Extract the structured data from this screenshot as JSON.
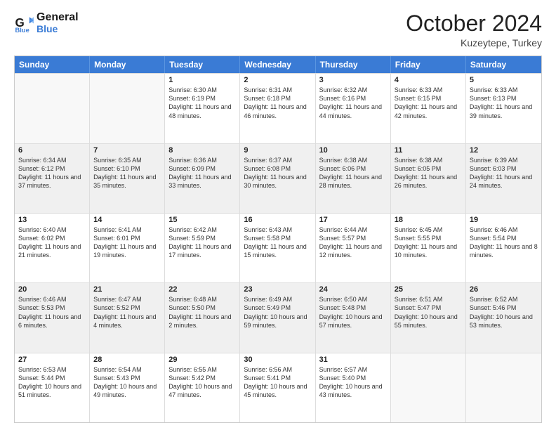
{
  "header": {
    "logo_line1": "General",
    "logo_line2": "Blue",
    "month": "October 2024",
    "location": "Kuzeytepe, Turkey"
  },
  "days": [
    "Sunday",
    "Monday",
    "Tuesday",
    "Wednesday",
    "Thursday",
    "Friday",
    "Saturday"
  ],
  "rows": [
    [
      {
        "day": "",
        "empty": true
      },
      {
        "day": "",
        "empty": true
      },
      {
        "day": "1",
        "sunrise": "6:30 AM",
        "sunset": "6:19 PM",
        "daylight": "11 hours and 48 minutes."
      },
      {
        "day": "2",
        "sunrise": "6:31 AM",
        "sunset": "6:18 PM",
        "daylight": "11 hours and 46 minutes."
      },
      {
        "day": "3",
        "sunrise": "6:32 AM",
        "sunset": "6:16 PM",
        "daylight": "11 hours and 44 minutes."
      },
      {
        "day": "4",
        "sunrise": "6:33 AM",
        "sunset": "6:15 PM",
        "daylight": "11 hours and 42 minutes."
      },
      {
        "day": "5",
        "sunrise": "6:33 AM",
        "sunset": "6:13 PM",
        "daylight": "11 hours and 39 minutes."
      }
    ],
    [
      {
        "day": "6",
        "sunrise": "6:34 AM",
        "sunset": "6:12 PM",
        "daylight": "11 hours and 37 minutes."
      },
      {
        "day": "7",
        "sunrise": "6:35 AM",
        "sunset": "6:10 PM",
        "daylight": "11 hours and 35 minutes."
      },
      {
        "day": "8",
        "sunrise": "6:36 AM",
        "sunset": "6:09 PM",
        "daylight": "11 hours and 33 minutes."
      },
      {
        "day": "9",
        "sunrise": "6:37 AM",
        "sunset": "6:08 PM",
        "daylight": "11 hours and 30 minutes."
      },
      {
        "day": "10",
        "sunrise": "6:38 AM",
        "sunset": "6:06 PM",
        "daylight": "11 hours and 28 minutes."
      },
      {
        "day": "11",
        "sunrise": "6:38 AM",
        "sunset": "6:05 PM",
        "daylight": "11 hours and 26 minutes."
      },
      {
        "day": "12",
        "sunrise": "6:39 AM",
        "sunset": "6:03 PM",
        "daylight": "11 hours and 24 minutes."
      }
    ],
    [
      {
        "day": "13",
        "sunrise": "6:40 AM",
        "sunset": "6:02 PM",
        "daylight": "11 hours and 21 minutes."
      },
      {
        "day": "14",
        "sunrise": "6:41 AM",
        "sunset": "6:01 PM",
        "daylight": "11 hours and 19 minutes."
      },
      {
        "day": "15",
        "sunrise": "6:42 AM",
        "sunset": "5:59 PM",
        "daylight": "11 hours and 17 minutes."
      },
      {
        "day": "16",
        "sunrise": "6:43 AM",
        "sunset": "5:58 PM",
        "daylight": "11 hours and 15 minutes."
      },
      {
        "day": "17",
        "sunrise": "6:44 AM",
        "sunset": "5:57 PM",
        "daylight": "11 hours and 12 minutes."
      },
      {
        "day": "18",
        "sunrise": "6:45 AM",
        "sunset": "5:55 PM",
        "daylight": "11 hours and 10 minutes."
      },
      {
        "day": "19",
        "sunrise": "6:46 AM",
        "sunset": "5:54 PM",
        "daylight": "11 hours and 8 minutes."
      }
    ],
    [
      {
        "day": "20",
        "sunrise": "6:46 AM",
        "sunset": "5:53 PM",
        "daylight": "11 hours and 6 minutes."
      },
      {
        "day": "21",
        "sunrise": "6:47 AM",
        "sunset": "5:52 PM",
        "daylight": "11 hours and 4 minutes."
      },
      {
        "day": "22",
        "sunrise": "6:48 AM",
        "sunset": "5:50 PM",
        "daylight": "11 hours and 2 minutes."
      },
      {
        "day": "23",
        "sunrise": "6:49 AM",
        "sunset": "5:49 PM",
        "daylight": "10 hours and 59 minutes."
      },
      {
        "day": "24",
        "sunrise": "6:50 AM",
        "sunset": "5:48 PM",
        "daylight": "10 hours and 57 minutes."
      },
      {
        "day": "25",
        "sunrise": "6:51 AM",
        "sunset": "5:47 PM",
        "daylight": "10 hours and 55 minutes."
      },
      {
        "day": "26",
        "sunrise": "6:52 AM",
        "sunset": "5:46 PM",
        "daylight": "10 hours and 53 minutes."
      }
    ],
    [
      {
        "day": "27",
        "sunrise": "6:53 AM",
        "sunset": "5:44 PM",
        "daylight": "10 hours and 51 minutes."
      },
      {
        "day": "28",
        "sunrise": "6:54 AM",
        "sunset": "5:43 PM",
        "daylight": "10 hours and 49 minutes."
      },
      {
        "day": "29",
        "sunrise": "6:55 AM",
        "sunset": "5:42 PM",
        "daylight": "10 hours and 47 minutes."
      },
      {
        "day": "30",
        "sunrise": "6:56 AM",
        "sunset": "5:41 PM",
        "daylight": "10 hours and 45 minutes."
      },
      {
        "day": "31",
        "sunrise": "6:57 AM",
        "sunset": "5:40 PM",
        "daylight": "10 hours and 43 minutes."
      },
      {
        "day": "",
        "empty": true
      },
      {
        "day": "",
        "empty": true
      }
    ]
  ],
  "labels": {
    "sunrise": "Sunrise:",
    "sunset": "Sunset:",
    "daylight": "Daylight:"
  }
}
